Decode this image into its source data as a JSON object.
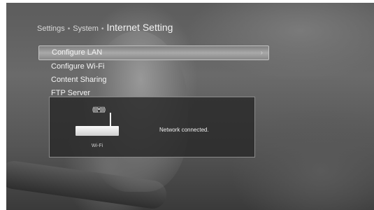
{
  "breadcrumb": {
    "items": [
      "Settings",
      "System"
    ],
    "separator": "•",
    "current": "Internet Setting"
  },
  "menu": {
    "items": [
      {
        "label": "Configure LAN",
        "selected": true
      },
      {
        "label": "Configure Wi-Fi",
        "selected": false
      },
      {
        "label": "Content Sharing",
        "selected": false
      },
      {
        "label": "FTP Server",
        "selected": false
      }
    ],
    "chevron": "›"
  },
  "status_panel": {
    "device_label": "Wi-Fi",
    "status_text": "Network connected.",
    "waves": "((((•))))",
    "icon": "wifi-router-icon"
  },
  "colors": {
    "panel_bg": "#282828",
    "highlight": "#a9a9a9"
  }
}
